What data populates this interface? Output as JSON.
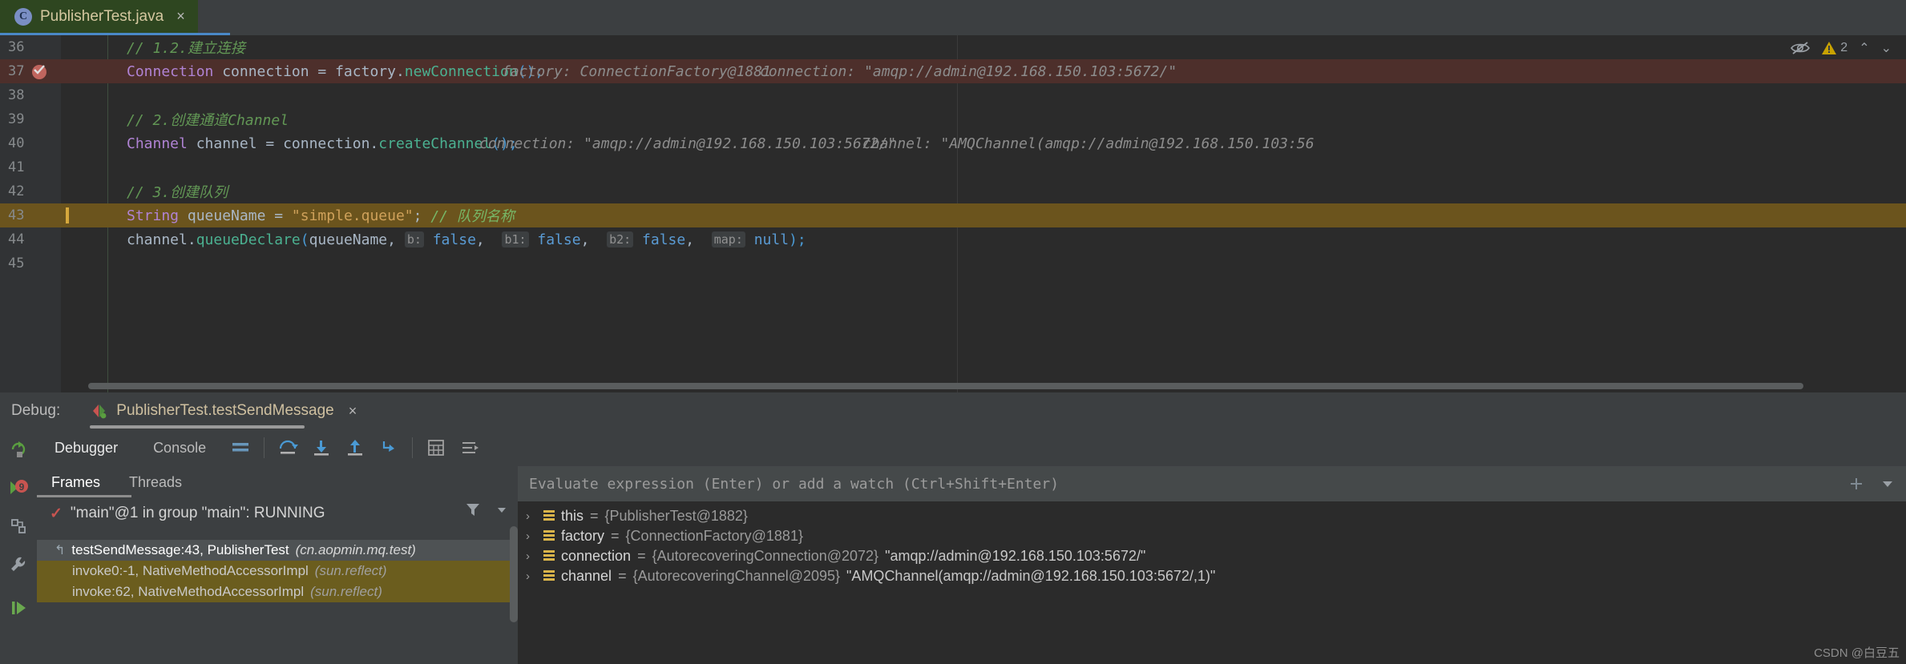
{
  "editor_tab": {
    "icon": "java-class-icon",
    "label": "PublisherTest.java",
    "close": "×"
  },
  "inspection_widget": {
    "eye_icon": "eye-off-icon",
    "warning_icon": "warning-triangle-icon",
    "warning_count": "2",
    "up_icon": "⌃",
    "down_icon": "⌄"
  },
  "code": {
    "lines": [
      {
        "number": "36",
        "gutter": "none",
        "highlight": "none",
        "text": "// 1.2.建立连接"
      },
      {
        "number": "37",
        "gutter": "breakpoint-verified-icon",
        "highlight": "breakpoint",
        "text": "Connection connection = factory.newConnection();",
        "hint1": "factory:  ConnectionFactory@1881",
        "hint2": "connection:  \"amqp://admin@192.168.150.103:5672/\""
      },
      {
        "number": "38",
        "gutter": "none",
        "highlight": "none",
        "text": ""
      },
      {
        "number": "39",
        "gutter": "none",
        "highlight": "none",
        "text": "// 2.创建通道Channel"
      },
      {
        "number": "40",
        "gutter": "none",
        "highlight": "none",
        "text": "Channel channel = connection.createChannel();",
        "hint1": "connection:  \"amqp://admin@192.168.150.103:5672/\"",
        "hint2": "channel:  \"AMQChannel(amqp://admin@192.168.150.103:56"
      },
      {
        "number": "41",
        "gutter": "none",
        "highlight": "none",
        "text": ""
      },
      {
        "number": "42",
        "gutter": "none",
        "highlight": "none",
        "text": "// 3.创建队列"
      },
      {
        "number": "43",
        "gutter": "exec-pointer",
        "highlight": "execution",
        "text": "String queueName = \"simple.queue\"; // 队列名称"
      },
      {
        "number": "44",
        "gutter": "none",
        "highlight": "none",
        "text": "channel.queueDeclare(queueName, b: false, b1: false, b2: false, map: null);"
      },
      {
        "number": "45",
        "gutter": "none",
        "highlight": "none",
        "text": ""
      }
    ],
    "tokens": {
      "line36_comment": "// 1.2.建立连接",
      "line37_type": "Connection",
      "line37_var": " connection = factory.",
      "line37_method": "newConnection",
      "line37_end": "();",
      "line37_hint_factory_label": "factory:",
      "line37_hint_factory_value": "ConnectionFactory@1881",
      "line37_hint_conn_label": "connection:",
      "line37_hint_conn_value": "\"amqp://admin@192.168.150.103:5672/\"",
      "line39_comment": "// 2.创建通道Channel",
      "line40_type": "Channel",
      "line40_var": " channel = connection.",
      "line40_method": "createChannel",
      "line40_end": "();",
      "line40_hint_conn_label": "connection:",
      "line40_hint_conn_value": "\"amqp://admin@192.168.150.103:5672/\"",
      "line40_hint_chan_label": "channel:",
      "line40_hint_chan_value": "\"AMQChannel(amqp://admin@192.168.150.103:56",
      "line42_comment": "// 3.创建队列",
      "line43_type": "String",
      "line43_var": " queueName = ",
      "line43_str": "\"simple.queue\"",
      "line43_semi": ";",
      "line43_comment": "// 队列名称",
      "line44_obj": "channel.",
      "line44_method": "queueDeclare",
      "line44_open": "(",
      "line44_arg": "queueName,",
      "line44_p1": "b:",
      "line44_v1": "false",
      "line44_p2": "b1:",
      "line44_v2": "false",
      "line44_p3": "b2:",
      "line44_v3": "false",
      "line44_p4": "map:",
      "line44_v4": "null",
      "line44_close": ");"
    }
  },
  "debug_header": {
    "label": "Debug:",
    "run_config_icon": "run-configuration-icon",
    "run_config_name": "PublisherTest.testSendMessage",
    "close": "×"
  },
  "debug_toolbar": {
    "rerun_icon": "rerun-icon",
    "tabs": [
      {
        "label": "Debugger",
        "active": true
      },
      {
        "label": "Console",
        "active": false
      }
    ],
    "buttons": [
      {
        "name": "layout-icon",
        "title": "Layout"
      },
      {
        "name": "step-over-icon",
        "title": "Step Over"
      },
      {
        "name": "step-into-icon",
        "title": "Step Into"
      },
      {
        "name": "step-out-icon",
        "title": "Step Out"
      },
      {
        "name": "force-step-into-icon",
        "title": "Force Step Into"
      },
      {
        "name": "evaluate-expression-icon",
        "title": "Evaluate Expression"
      },
      {
        "name": "mute-breakpoints-icon",
        "title": "Mute Breakpoints"
      }
    ]
  },
  "left_rail": [
    {
      "name": "resume-program-icon"
    },
    {
      "name": "view-breakpoints-icon"
    },
    {
      "name": "restore-layout-icon"
    },
    {
      "name": "settings-wrench-icon"
    },
    {
      "name": "resume-icon"
    }
  ],
  "frames_panel": {
    "tabs": [
      {
        "label": "Frames",
        "active": true
      },
      {
        "label": "Threads",
        "active": false
      }
    ],
    "filter_icon": "filter-icon",
    "dropdown_icon": "chevron-down-icon",
    "thread": {
      "check_icon": "check-icon",
      "text": "\"main\"@1 in group \"main\": RUNNING"
    },
    "frames": [
      {
        "icon": "return-arrow-icon",
        "method": "testSendMessage:43, PublisherTest",
        "package": "(cn.aopmin.mq.test)",
        "selected": true
      },
      {
        "icon": "none",
        "method": "invoke0:-1, NativeMethodAccessorImpl",
        "package": "(sun.reflect)",
        "selected": false
      },
      {
        "icon": "none",
        "method": "invoke:62, NativeMethodAccessorImpl",
        "package": "(sun.reflect)",
        "selected": false
      }
    ]
  },
  "variables_panel": {
    "evaluate_placeholder": "Evaluate expression (Enter) or add a watch (Ctrl+Shift+Enter)",
    "add_watch_icon": "add-watch-icon",
    "dropdown_icon": "chevron-down-icon",
    "rows": [
      {
        "chevron": "›",
        "icon": "field-icon",
        "name": "this",
        "eq": "=",
        "ref": "{PublisherTest@1882}",
        "value": ""
      },
      {
        "chevron": "›",
        "icon": "field-icon",
        "name": "factory",
        "eq": "=",
        "ref": "{ConnectionFactory@1881}",
        "value": ""
      },
      {
        "chevron": "›",
        "icon": "field-icon",
        "name": "connection",
        "eq": "=",
        "ref": "{AutorecoveringConnection@2072}",
        "value": "\"amqp://admin@192.168.150.103:5672/\""
      },
      {
        "chevron": "›",
        "icon": "field-icon",
        "name": "channel",
        "eq": "=",
        "ref": "{AutorecoveringChannel@2095}",
        "value": "\"AMQChannel(amqp://admin@192.168.150.103:5672/,1)\""
      }
    ]
  },
  "watermark": "CSDN @白豆五",
  "colors": {
    "editor_bg": "#2b2b2b",
    "panel_bg": "#3c3f41",
    "exec_line": "#6b541d",
    "breakpoint_line": "#4d2f2b",
    "tab_active": "#2e4620",
    "accent_blue": "#4a88c7"
  }
}
